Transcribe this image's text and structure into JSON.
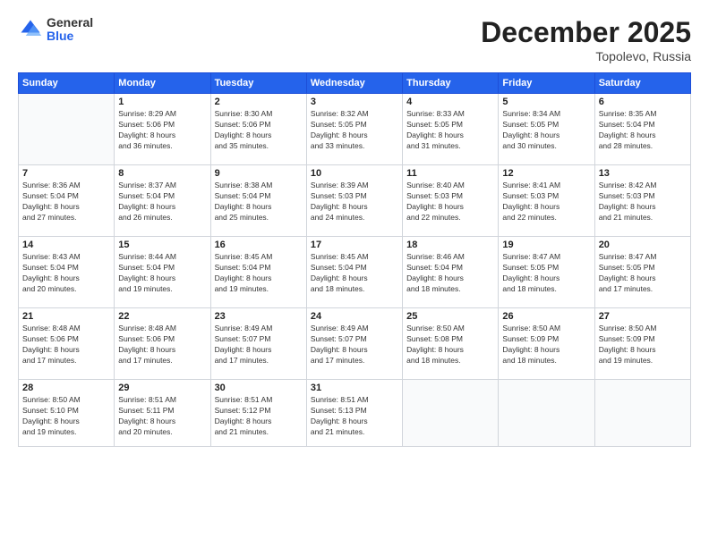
{
  "logo": {
    "general": "General",
    "blue": "Blue"
  },
  "title": "December 2025",
  "location": "Topolevo, Russia",
  "weekdays": [
    "Sunday",
    "Monday",
    "Tuesday",
    "Wednesday",
    "Thursday",
    "Friday",
    "Saturday"
  ],
  "weeks": [
    [
      {
        "day": "",
        "info": ""
      },
      {
        "day": "1",
        "info": "Sunrise: 8:29 AM\nSunset: 5:06 PM\nDaylight: 8 hours\nand 36 minutes."
      },
      {
        "day": "2",
        "info": "Sunrise: 8:30 AM\nSunset: 5:06 PM\nDaylight: 8 hours\nand 35 minutes."
      },
      {
        "day": "3",
        "info": "Sunrise: 8:32 AM\nSunset: 5:05 PM\nDaylight: 8 hours\nand 33 minutes."
      },
      {
        "day": "4",
        "info": "Sunrise: 8:33 AM\nSunset: 5:05 PM\nDaylight: 8 hours\nand 31 minutes."
      },
      {
        "day": "5",
        "info": "Sunrise: 8:34 AM\nSunset: 5:05 PM\nDaylight: 8 hours\nand 30 minutes."
      },
      {
        "day": "6",
        "info": "Sunrise: 8:35 AM\nSunset: 5:04 PM\nDaylight: 8 hours\nand 28 minutes."
      }
    ],
    [
      {
        "day": "7",
        "info": "Sunrise: 8:36 AM\nSunset: 5:04 PM\nDaylight: 8 hours\nand 27 minutes."
      },
      {
        "day": "8",
        "info": "Sunrise: 8:37 AM\nSunset: 5:04 PM\nDaylight: 8 hours\nand 26 minutes."
      },
      {
        "day": "9",
        "info": "Sunrise: 8:38 AM\nSunset: 5:04 PM\nDaylight: 8 hours\nand 25 minutes."
      },
      {
        "day": "10",
        "info": "Sunrise: 8:39 AM\nSunset: 5:03 PM\nDaylight: 8 hours\nand 24 minutes."
      },
      {
        "day": "11",
        "info": "Sunrise: 8:40 AM\nSunset: 5:03 PM\nDaylight: 8 hours\nand 22 minutes."
      },
      {
        "day": "12",
        "info": "Sunrise: 8:41 AM\nSunset: 5:03 PM\nDaylight: 8 hours\nand 22 minutes."
      },
      {
        "day": "13",
        "info": "Sunrise: 8:42 AM\nSunset: 5:03 PM\nDaylight: 8 hours\nand 21 minutes."
      }
    ],
    [
      {
        "day": "14",
        "info": "Sunrise: 8:43 AM\nSunset: 5:04 PM\nDaylight: 8 hours\nand 20 minutes."
      },
      {
        "day": "15",
        "info": "Sunrise: 8:44 AM\nSunset: 5:04 PM\nDaylight: 8 hours\nand 19 minutes."
      },
      {
        "day": "16",
        "info": "Sunrise: 8:45 AM\nSunset: 5:04 PM\nDaylight: 8 hours\nand 19 minutes."
      },
      {
        "day": "17",
        "info": "Sunrise: 8:45 AM\nSunset: 5:04 PM\nDaylight: 8 hours\nand 18 minutes."
      },
      {
        "day": "18",
        "info": "Sunrise: 8:46 AM\nSunset: 5:04 PM\nDaylight: 8 hours\nand 18 minutes."
      },
      {
        "day": "19",
        "info": "Sunrise: 8:47 AM\nSunset: 5:05 PM\nDaylight: 8 hours\nand 18 minutes."
      },
      {
        "day": "20",
        "info": "Sunrise: 8:47 AM\nSunset: 5:05 PM\nDaylight: 8 hours\nand 17 minutes."
      }
    ],
    [
      {
        "day": "21",
        "info": "Sunrise: 8:48 AM\nSunset: 5:06 PM\nDaylight: 8 hours\nand 17 minutes."
      },
      {
        "day": "22",
        "info": "Sunrise: 8:48 AM\nSunset: 5:06 PM\nDaylight: 8 hours\nand 17 minutes."
      },
      {
        "day": "23",
        "info": "Sunrise: 8:49 AM\nSunset: 5:07 PM\nDaylight: 8 hours\nand 17 minutes."
      },
      {
        "day": "24",
        "info": "Sunrise: 8:49 AM\nSunset: 5:07 PM\nDaylight: 8 hours\nand 17 minutes."
      },
      {
        "day": "25",
        "info": "Sunrise: 8:50 AM\nSunset: 5:08 PM\nDaylight: 8 hours\nand 18 minutes."
      },
      {
        "day": "26",
        "info": "Sunrise: 8:50 AM\nSunset: 5:09 PM\nDaylight: 8 hours\nand 18 minutes."
      },
      {
        "day": "27",
        "info": "Sunrise: 8:50 AM\nSunset: 5:09 PM\nDaylight: 8 hours\nand 19 minutes."
      }
    ],
    [
      {
        "day": "28",
        "info": "Sunrise: 8:50 AM\nSunset: 5:10 PM\nDaylight: 8 hours\nand 19 minutes."
      },
      {
        "day": "29",
        "info": "Sunrise: 8:51 AM\nSunset: 5:11 PM\nDaylight: 8 hours\nand 20 minutes."
      },
      {
        "day": "30",
        "info": "Sunrise: 8:51 AM\nSunset: 5:12 PM\nDaylight: 8 hours\nand 21 minutes."
      },
      {
        "day": "31",
        "info": "Sunrise: 8:51 AM\nSunset: 5:13 PM\nDaylight: 8 hours\nand 21 minutes."
      },
      {
        "day": "",
        "info": ""
      },
      {
        "day": "",
        "info": ""
      },
      {
        "day": "",
        "info": ""
      }
    ]
  ]
}
